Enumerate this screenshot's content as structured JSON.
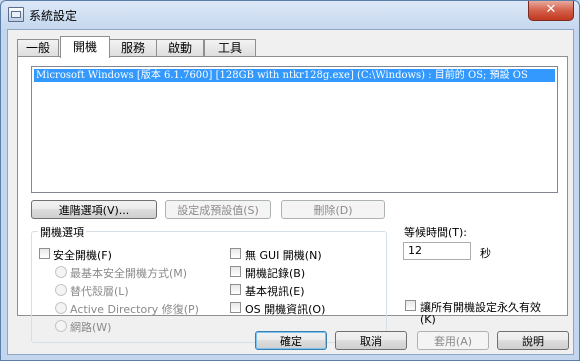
{
  "window": {
    "title": "系統設定",
    "close_glyph": "✕"
  },
  "tabs": [
    {
      "label": "一般",
      "active": false
    },
    {
      "label": "開機",
      "active": true
    },
    {
      "label": "服務",
      "active": false
    },
    {
      "label": "啟動",
      "active": false
    },
    {
      "label": "工具",
      "active": false
    }
  ],
  "boot_list": {
    "items": [
      {
        "text": "Microsoft Windows [版本 6.1.7600] [128GB with ntkr128g.exe] (C:\\Windows) : 目前的 OS; 預設 OS",
        "selected": true
      }
    ]
  },
  "boot_buttons": {
    "advanced": "進階選項(V)...",
    "set_default": "設定成預設值(S)",
    "delete": "刪除(D)"
  },
  "boot_options": {
    "legend": "開機選項",
    "safe_boot": "安全開機(F)",
    "minimal": "最基本安全開機方式(M)",
    "alternate_shell": "替代殼層(L)",
    "ad_repair": "Active Directory 修復(P)",
    "network": "網路(W)",
    "no_gui": "無 GUI 開機(N)",
    "boot_log": "開機記錄(B)",
    "base_video": "基本視訊(E)",
    "os_info": "OS 開機資訊(O)"
  },
  "timeout": {
    "label": "等候時間(T):",
    "value": "12",
    "unit": "秒"
  },
  "permanent": {
    "label_line1": "讓所有開機設定永久有效",
    "label_line2": "(K)"
  },
  "dialog_buttons": {
    "ok": "確定",
    "cancel": "取消",
    "apply": "套用(A)",
    "help": "說明"
  },
  "colors": {
    "selection": "#3399ff",
    "close_button": "#c2381e"
  }
}
